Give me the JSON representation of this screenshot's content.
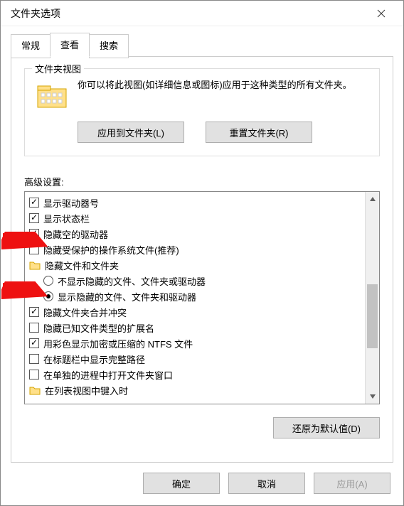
{
  "window": {
    "title": "文件夹选项",
    "tabs": [
      "常规",
      "查看",
      "搜索"
    ],
    "active_tab": 1
  },
  "folder_view": {
    "legend": "文件夹视图",
    "description": "你可以将此视图(如详细信息或图标)应用于这种类型的所有文件夹。",
    "apply_button": "应用到文件夹(L)",
    "reset_button": "重置文件夹(R)"
  },
  "advanced": {
    "label": "高级设置:",
    "items": [
      {
        "type": "checkbox",
        "checked": true,
        "label": "显示驱动器号"
      },
      {
        "type": "checkbox",
        "checked": true,
        "label": "显示状态栏"
      },
      {
        "type": "checkbox",
        "checked": true,
        "label": "隐藏空的驱动器"
      },
      {
        "type": "checkbox",
        "checked": false,
        "label": "隐藏受保护的操作系统文件(推荐)"
      },
      {
        "type": "group",
        "label": "隐藏文件和文件夹"
      },
      {
        "type": "radio",
        "checked": false,
        "label": "不显示隐藏的文件、文件夹或驱动器",
        "indent": true
      },
      {
        "type": "radio",
        "checked": true,
        "label": "显示隐藏的文件、文件夹和驱动器",
        "indent": true
      },
      {
        "type": "checkbox",
        "checked": true,
        "label": "隐藏文件夹合并冲突"
      },
      {
        "type": "checkbox",
        "checked": false,
        "label": "隐藏已知文件类型的扩展名"
      },
      {
        "type": "checkbox",
        "checked": true,
        "label": "用彩色显示加密或压缩的 NTFS 文件"
      },
      {
        "type": "checkbox",
        "checked": false,
        "label": "在标题栏中显示完整路径"
      },
      {
        "type": "checkbox",
        "checked": false,
        "label": "在单独的进程中打开文件夹窗口"
      },
      {
        "type": "group",
        "label": "在列表视图中键入时"
      }
    ]
  },
  "restore_defaults_button": "还原为默认值(D)",
  "dialog_buttons": {
    "ok": "确定",
    "cancel": "取消",
    "apply": "应用(A)"
  }
}
